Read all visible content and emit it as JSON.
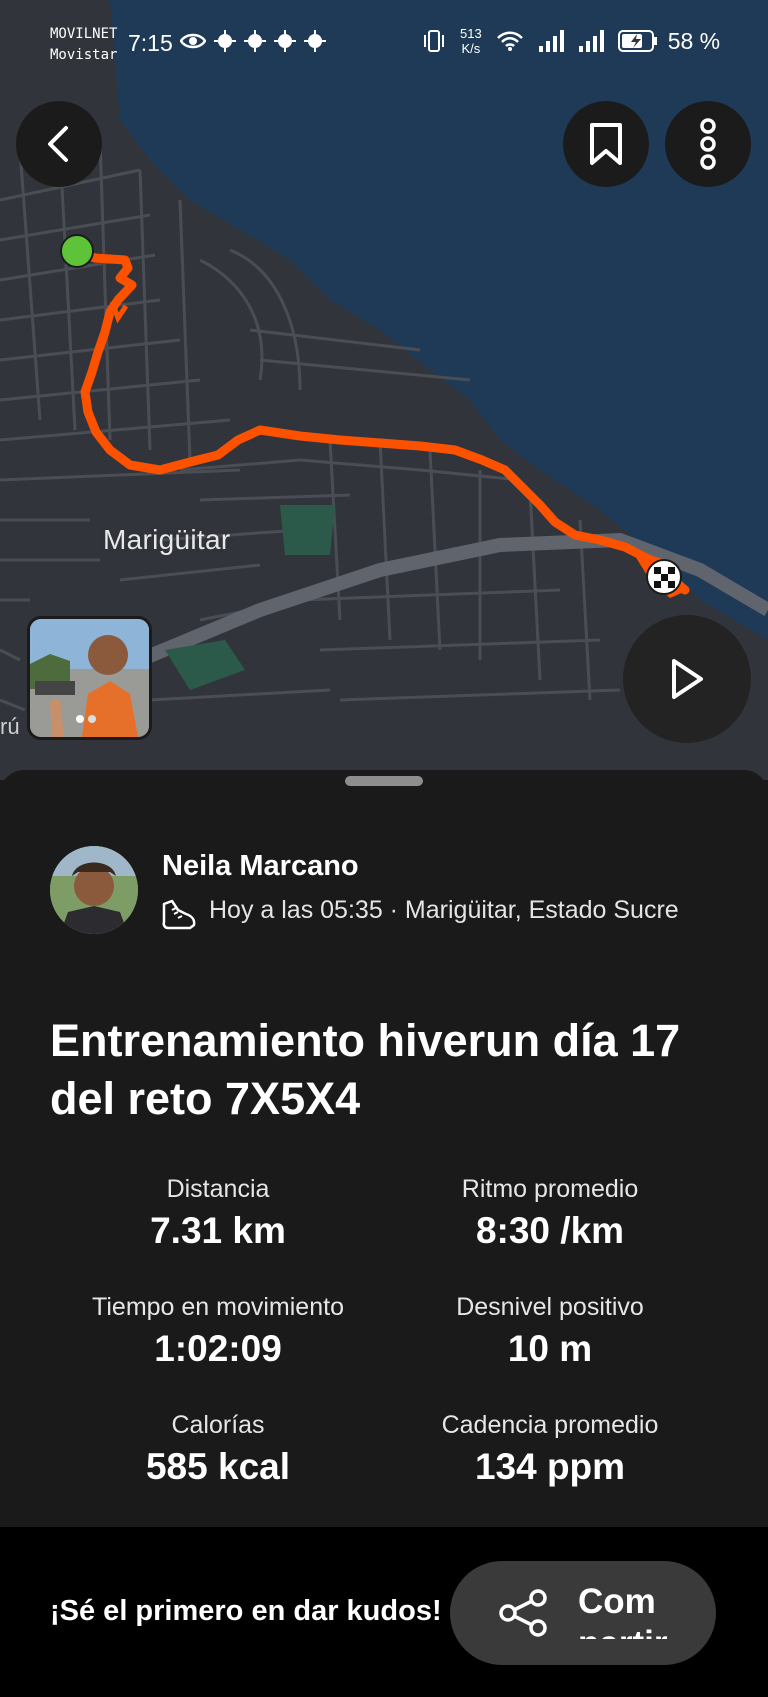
{
  "status_bar": {
    "carrier_1": "MOVILNET",
    "carrier_2": "Movistar",
    "time": "7:15",
    "net_speed_value": "513",
    "net_speed_unit": "K/s",
    "battery_percent": "58 %",
    "icons": [
      "eye-icon",
      "weather-icon",
      "weather-icon",
      "weather-icon",
      "weather-icon",
      "vibrate-icon",
      "wifi-icon",
      "signal-icon",
      "signal-icon",
      "battery-charging-icon"
    ]
  },
  "map": {
    "place_label": "Marigüitar",
    "edge_label": "rú",
    "route_color": "#fc5200",
    "start_marker_color": "#5fc33a",
    "buttons": [
      "back-icon",
      "bookmark-icon",
      "more-vertical-icon",
      "play-icon"
    ]
  },
  "activity": {
    "athlete_name": "Neila Marcano",
    "meta": "Hoy a las 05:35 · Marigüitar, Estado Sucre",
    "sport_icon": "running-shoe-icon",
    "title": "Entrenamiento hiverun día 17 del reto 7X5X4",
    "stats": [
      {
        "label": "Distancia",
        "value": "7.31 km"
      },
      {
        "label": "Ritmo promedio",
        "value": "8:30 /km"
      },
      {
        "label": "Tiempo en movimiento",
        "value": "1:02:09"
      },
      {
        "label": "Desnivel positivo",
        "value": "10 m"
      },
      {
        "label": "Calorías",
        "value": "585 kcal"
      },
      {
        "label": "Cadencia promedio",
        "value": "134 ppm"
      }
    ]
  },
  "footer": {
    "kudos_text": "¡Sé el primero en dar kudos!",
    "share_label": "Compartir",
    "share_icon": "share-icon"
  }
}
